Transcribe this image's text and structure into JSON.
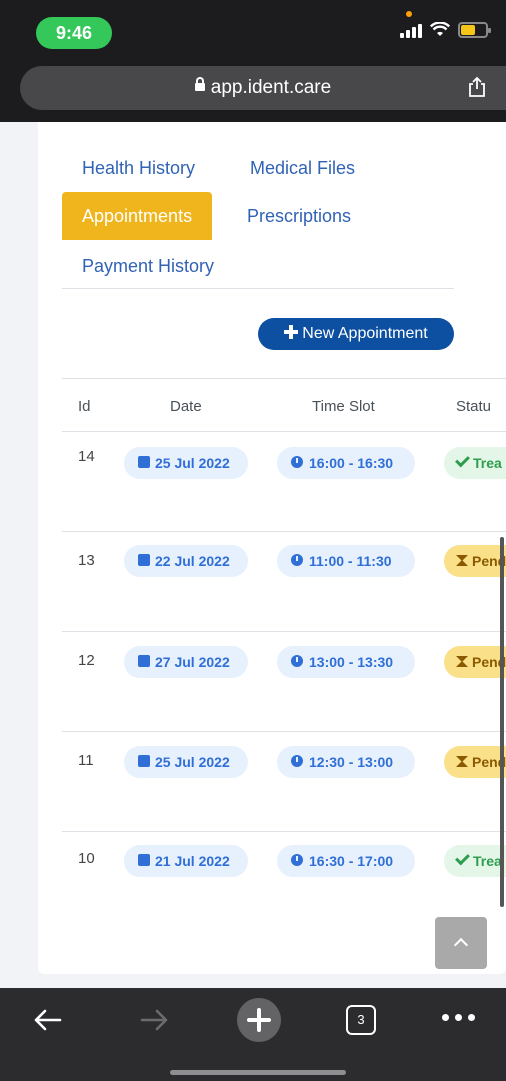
{
  "status_bar": {
    "time": "9:46"
  },
  "browser": {
    "url": "app.ident.care",
    "tab_count": "3"
  },
  "tabs": [
    {
      "label": "Health History",
      "active": false
    },
    {
      "label": "Medical Files",
      "active": false
    },
    {
      "label": "Appointments",
      "active": true
    },
    {
      "label": "Prescriptions",
      "active": false
    },
    {
      "label": "Payment History",
      "active": false
    }
  ],
  "new_appointment_label": "New Appointment",
  "table": {
    "headers": {
      "id": "Id",
      "date": "Date",
      "time_slot": "Time Slot",
      "status": "Statu"
    },
    "rows": [
      {
        "id": "14",
        "date": "25 Jul 2022",
        "time_slot": "16:00 - 16:30",
        "status": "Trea",
        "status_type": "treated"
      },
      {
        "id": "13",
        "date": "22 Jul 2022",
        "time_slot": "11:00 - 11:30",
        "status": "Pend",
        "status_type": "pending"
      },
      {
        "id": "12",
        "date": "27 Jul 2022",
        "time_slot": "13:00 - 13:30",
        "status": "Pend",
        "status_type": "pending"
      },
      {
        "id": "11",
        "date": "25 Jul 2022",
        "time_slot": "12:30 - 13:00",
        "status": "Pend",
        "status_type": "pending"
      },
      {
        "id": "10",
        "date": "21 Jul 2022",
        "time_slot": "16:30 - 17:00",
        "status": "Trea",
        "status_type": "treated"
      }
    ]
  },
  "colors": {
    "accent_tab": "#f0b41c",
    "primary_button": "#0d4fa0",
    "link": "#3163b5",
    "treated": "#2e9e4e",
    "pending": "#fbe08a"
  },
  "icons": {
    "toolbar": [
      "back-arrow-icon",
      "forward-arrow-icon",
      "new-tab-plus-icon",
      "tabs-icon",
      "more-icon"
    ]
  }
}
